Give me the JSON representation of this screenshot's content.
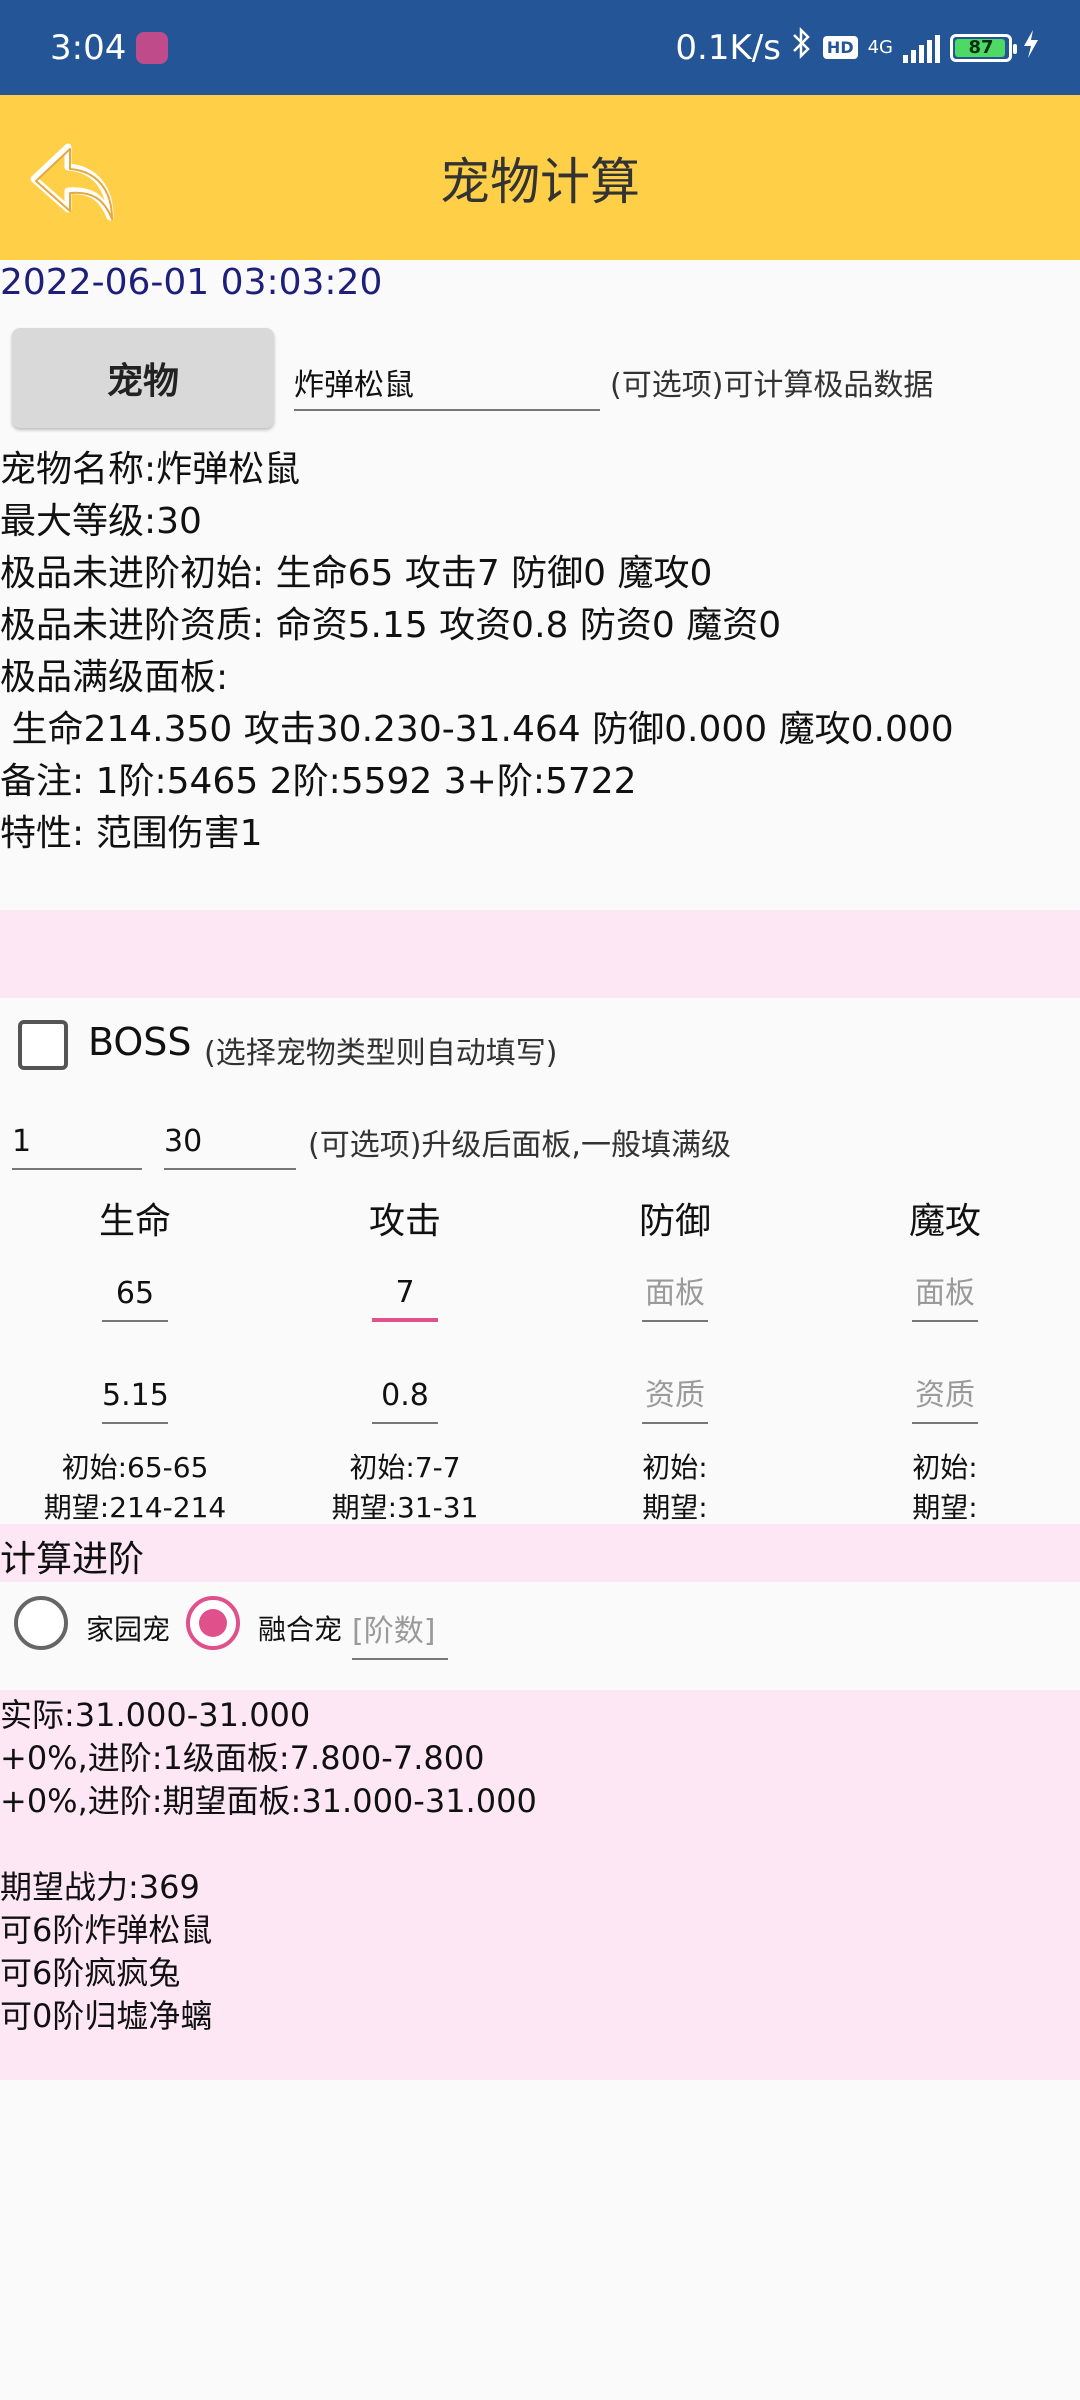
{
  "status_bar": {
    "time": "3:04",
    "net_speed": "0.1K/s",
    "hd": "HD",
    "network": "4G",
    "battery": "87"
  },
  "app_bar": {
    "title": "宠物计算"
  },
  "datetime": "2022-06-01 03:03:20",
  "pet_selector": {
    "button_label": "宠物",
    "input_value": "炸弹松鼠",
    "hint": "(可选项)可计算极品数据"
  },
  "pet_info": [
    "宠物名称:炸弹松鼠",
    "最大等级:30",
    "极品未进阶初始: 生命65 攻击7 防御0 魔攻0",
    "极品未进阶资质: 命资5.15 攻资0.8 防资0 魔资0",
    "极品满级面板:",
    " 生命214.350 攻击30.230-31.464 防御0.000 魔攻0.000",
    "备注: 1阶:5465 2阶:5592 3+阶:5722",
    "特性: 范围伤害1"
  ],
  "boss": {
    "label": "BOSS",
    "hint": "(选择宠物类型则自动填写)",
    "checked": false
  },
  "levels": {
    "from": "1",
    "to": "30",
    "hint": "(可选项)升级后面板,一般填满级"
  },
  "stats": [
    {
      "header": "生命",
      "panel": "65",
      "panel_placeholder": "面板",
      "aptitude": "5.15",
      "aptitude_placeholder": "资质",
      "initial": "初始:65-65",
      "expected": "期望:214-214"
    },
    {
      "header": "攻击",
      "panel": "7",
      "panel_placeholder": "面板",
      "aptitude": "0.8",
      "aptitude_placeholder": "资质",
      "initial": "初始:7-7",
      "expected": "期望:31-31"
    },
    {
      "header": "防御",
      "panel": "",
      "panel_placeholder": "面板",
      "aptitude": "",
      "aptitude_placeholder": "资质",
      "initial": "初始:",
      "expected": "期望:"
    },
    {
      "header": "魔攻",
      "panel": "",
      "panel_placeholder": "面板",
      "aptitude": "",
      "aptitude_placeholder": "资质",
      "initial": "初始:",
      "expected": "期望:"
    }
  ],
  "advance": {
    "title": "计算进阶",
    "options": [
      {
        "label": "家园宠",
        "checked": false
      },
      {
        "label": "融合宠",
        "checked": true
      }
    ],
    "stage_placeholder": "[阶数]"
  },
  "results": [
    "实际:31.000-31.000",
    "+0%,进阶:1级面板:7.800-7.800",
    "+0%,进阶:期望面板:31.000-31.000",
    "",
    "期望战力:369",
    "可6阶炸弹松鼠",
    "可6阶疯疯兔",
    "可0阶归墟净螭"
  ],
  "colors": {
    "status_bar": "#235597",
    "app_bar": "#ffcf48",
    "accent": "#e0508a",
    "pink_band": "#fde7f5"
  }
}
